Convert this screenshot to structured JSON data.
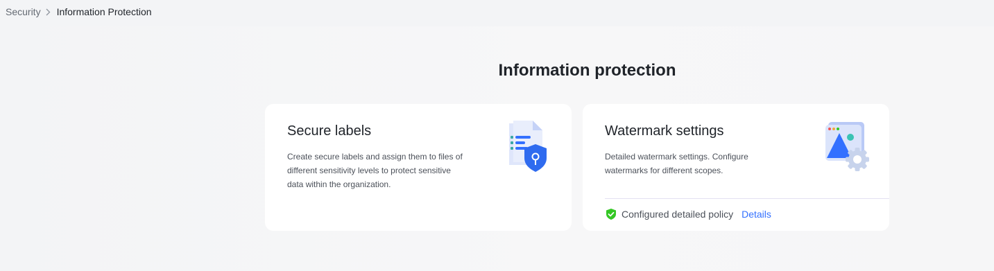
{
  "breadcrumb": {
    "parent": "Security",
    "current": "Information Protection"
  },
  "page": {
    "title": "Information protection"
  },
  "cards": [
    {
      "title": "Secure labels",
      "description": "Create secure labels and assign them to files of different sensitivity levels to protect sensitive data within the organization.",
      "icon": "document-shield-icon"
    },
    {
      "title": "Watermark settings",
      "description": "Detailed watermark settings. Configure watermarks for different scopes.",
      "icon": "image-gear-icon",
      "status": {
        "text": "Configured detailed policy",
        "icon": "check-shield-icon",
        "color": "#34c724"
      },
      "details_link": "Details"
    }
  ],
  "colors": {
    "accent": "#3370ff",
    "success": "#34c724",
    "background": "#f3f4f6",
    "card": "#ffffff"
  }
}
